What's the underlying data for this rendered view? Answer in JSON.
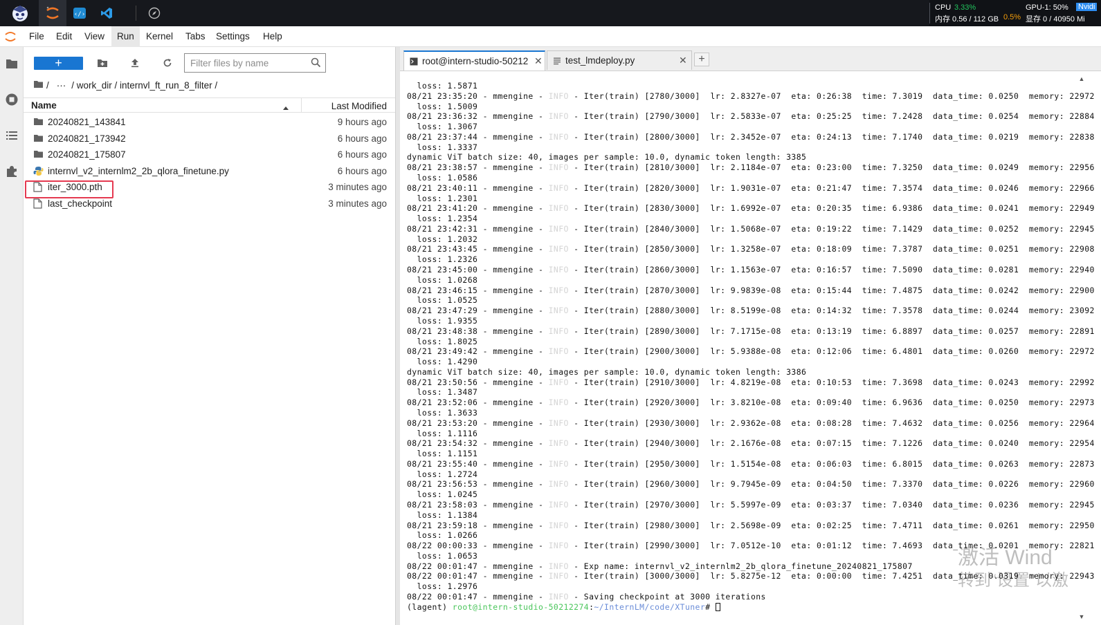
{
  "sysinfo": {
    "cpu_label": "CPU",
    "cpu_value": "3.33%",
    "mem_label": "内存 0.56 / 112 GB",
    "mem_value": "0.5%",
    "gpu_label": "GPU-1: 50%",
    "gpu_brand": "Nvidi",
    "vram_label": "显存 0 / 40950 Mi"
  },
  "menu": [
    "File",
    "Edit",
    "View",
    "Run",
    "Kernel",
    "Tabs",
    "Settings",
    "Help"
  ],
  "filebrowser": {
    "new_label": "+",
    "filter_placeholder": "Filter files by name",
    "breadcrumb": [
      "/",
      "···",
      "/ work_dir / internvl_ft_run_8_filter /"
    ],
    "col_name": "Name",
    "col_modified": "Last Modified",
    "files": [
      {
        "name": "20240821_143841",
        "modified": "9 hours ago",
        "type": "folder"
      },
      {
        "name": "20240821_173942",
        "modified": "6 hours ago",
        "type": "folder"
      },
      {
        "name": "20240821_175807",
        "modified": "6 hours ago",
        "type": "folder"
      },
      {
        "name": "internvl_v2_internlm2_2b_qlora_finetune.py",
        "modified": "6 hours ago",
        "type": "python"
      },
      {
        "name": "iter_3000.pth",
        "modified": "3 minutes ago",
        "type": "file"
      },
      {
        "name": "last_checkpoint",
        "modified": "3 minutes ago",
        "type": "file"
      }
    ]
  },
  "tabs": [
    {
      "label": "root@intern-studio-50212",
      "close": "✕"
    },
    {
      "label": "test_lmdeploy.py",
      "close": "✕"
    }
  ],
  "tab_add": "+",
  "terminal": {
    "lines": [
      [
        "  loss: 1.5871"
      ],
      [
        "08/21 23:35:20 - mmengine - ",
        "INFO",
        " - Iter(train) [2780/3000]  lr: 2.8327e-07  eta: 0:26:38  time: 7.3019  data_time: 0.0250  memory: 22972"
      ],
      [
        "  loss: 1.5009"
      ],
      [
        "08/21 23:36:32 - mmengine - ",
        "INFO",
        " - Iter(train) [2790/3000]  lr: 2.5833e-07  eta: 0:25:25  time: 7.2428  data_time: 0.0254  memory: 22884"
      ],
      [
        "  loss: 1.3067"
      ],
      [
        "08/21 23:37:44 - mmengine - ",
        "INFO",
        " - Iter(train) [2800/3000]  lr: 2.3452e-07  eta: 0:24:13  time: 7.1740  data_time: 0.0219  memory: 22838"
      ],
      [
        "  loss: 1.3337"
      ],
      [
        "dynamic ViT batch size: 40, images per sample: 10.0, dynamic token length: 3385"
      ],
      [
        "08/21 23:38:57 - mmengine - ",
        "INFO",
        " - Iter(train) [2810/3000]  lr: 2.1184e-07  eta: 0:23:00  time: 7.3250  data_time: 0.0249  memory: 22956"
      ],
      [
        "  loss: 1.0586"
      ],
      [
        "08/21 23:40:11 - mmengine - ",
        "INFO",
        " - Iter(train) [2820/3000]  lr: 1.9031e-07  eta: 0:21:47  time: 7.3574  data_time: 0.0246  memory: 22966"
      ],
      [
        "  loss: 1.2301"
      ],
      [
        "08/21 23:41:20 - mmengine - ",
        "INFO",
        " - Iter(train) [2830/3000]  lr: 1.6992e-07  eta: 0:20:35  time: 6.9386  data_time: 0.0241  memory: 22949"
      ],
      [
        "  loss: 1.2354"
      ],
      [
        "08/21 23:42:31 - mmengine - ",
        "INFO",
        " - Iter(train) [2840/3000]  lr: 1.5068e-07  eta: 0:19:22  time: 7.1429  data_time: 0.0252  memory: 22945"
      ],
      [
        "  loss: 1.2032"
      ],
      [
        "08/21 23:43:45 - mmengine - ",
        "INFO",
        " - Iter(train) [2850/3000]  lr: 1.3258e-07  eta: 0:18:09  time: 7.3787  data_time: 0.0251  memory: 22908"
      ],
      [
        "  loss: 1.2326"
      ],
      [
        "08/21 23:45:00 - mmengine - ",
        "INFO",
        " - Iter(train) [2860/3000]  lr: 1.1563e-07  eta: 0:16:57  time: 7.5090  data_time: 0.0281  memory: 22940"
      ],
      [
        "  loss: 1.0268"
      ],
      [
        "08/21 23:46:15 - mmengine - ",
        "INFO",
        " - Iter(train) [2870/3000]  lr: 9.9839e-08  eta: 0:15:44  time: 7.4875  data_time: 0.0242  memory: 22900"
      ],
      [
        "  loss: 1.0525"
      ],
      [
        "08/21 23:47:29 - mmengine - ",
        "INFO",
        " - Iter(train) [2880/3000]  lr: 8.5199e-08  eta: 0:14:32  time: 7.3578  data_time: 0.0244  memory: 23092"
      ],
      [
        "  loss: 1.9355"
      ],
      [
        "08/21 23:48:38 - mmengine - ",
        "INFO",
        " - Iter(train) [2890/3000]  lr: 7.1715e-08  eta: 0:13:19  time: 6.8897  data_time: 0.0257  memory: 22891"
      ],
      [
        "  loss: 1.8025"
      ],
      [
        "08/21 23:49:42 - mmengine - ",
        "INFO",
        " - Iter(train) [2900/3000]  lr: 5.9388e-08  eta: 0:12:06  time: 6.4801  data_time: 0.0260  memory: 22972"
      ],
      [
        "  loss: 1.4290"
      ],
      [
        "dynamic ViT batch size: 40, images per sample: 10.0, dynamic token length: 3386"
      ],
      [
        "08/21 23:50:56 - mmengine - ",
        "INFO",
        " - Iter(train) [2910/3000]  lr: 4.8219e-08  eta: 0:10:53  time: 7.3698  data_time: 0.0243  memory: 22992"
      ],
      [
        "  loss: 1.3487"
      ],
      [
        "08/21 23:52:06 - mmengine - ",
        "INFO",
        " - Iter(train) [2920/3000]  lr: 3.8210e-08  eta: 0:09:40  time: 6.9636  data_time: 0.0250  memory: 22973"
      ],
      [
        "  loss: 1.3633"
      ],
      [
        "08/21 23:53:20 - mmengine - ",
        "INFO",
        " - Iter(train) [2930/3000]  lr: 2.9362e-08  eta: 0:08:28  time: 7.4632  data_time: 0.0256  memory: 22964"
      ],
      [
        "  loss: 1.1116"
      ],
      [
        "08/21 23:54:32 - mmengine - ",
        "INFO",
        " - Iter(train) [2940/3000]  lr: 2.1676e-08  eta: 0:07:15  time: 7.1226  data_time: 0.0240  memory: 22954"
      ],
      [
        "  loss: 1.1151"
      ],
      [
        "08/21 23:55:40 - mmengine - ",
        "INFO",
        " - Iter(train) [2950/3000]  lr: 1.5154e-08  eta: 0:06:03  time: 6.8015  data_time: 0.0263  memory: 22873"
      ],
      [
        "  loss: 1.2724"
      ],
      [
        "08/21 23:56:53 - mmengine - ",
        "INFO",
        " - Iter(train) [2960/3000]  lr: 9.7945e-09  eta: 0:04:50  time: 7.3370  data_time: 0.0226  memory: 22960"
      ],
      [
        "  loss: 1.0245"
      ],
      [
        "08/21 23:58:03 - mmengine - ",
        "INFO",
        " - Iter(train) [2970/3000]  lr: 5.5997e-09  eta: 0:03:37  time: 7.0340  data_time: 0.0236  memory: 22945"
      ],
      [
        "  loss: 1.1384"
      ],
      [
        "08/21 23:59:18 - mmengine - ",
        "INFO",
        " - Iter(train) [2980/3000]  lr: 2.5698e-09  eta: 0:02:25  time: 7.4711  data_time: 0.0261  memory: 22950"
      ],
      [
        "  loss: 1.0266"
      ],
      [
        "08/22 00:00:33 - mmengine - ",
        "INFO",
        " - Iter(train) [2990/3000]  lr: 7.0512e-10  eta: 0:01:12  time: 7.4693  data_time: 0.0201  memory: 22821"
      ],
      [
        "  loss: 1.0653"
      ],
      [
        "08/22 00:01:47 - mmengine - ",
        "INFO",
        " - Exp name: internvl_v2_internlm2_2b_qlora_finetune_20240821_175807"
      ],
      [
        "08/22 00:01:47 - mmengine - ",
        "INFO",
        " - Iter(train) [3000/3000]  lr: 5.8275e-12  eta: 0:00:00  time: 7.4251  data_time: 0.0319  memory: 22943"
      ],
      [
        "  loss: 1.2976"
      ],
      [
        "08/22 00:01:47 - mmengine - ",
        "INFO",
        " - Saving checkpoint at 3000 iterations"
      ]
    ],
    "prompt_env": "(lagent) ",
    "prompt_host": "root@intern-studio-50212274",
    "prompt_colon": ":",
    "prompt_path": "~/InternLM/code/XTuner",
    "prompt_end": "# "
  },
  "watermark": {
    "line1": "激活 Wind",
    "line2": "转到“设置”以激"
  },
  "colors": {
    "accent": "#1976d2",
    "highlight_box": "#e53950",
    "prompt_green": "#49c55a",
    "prompt_blue": "#6a8cd8"
  }
}
